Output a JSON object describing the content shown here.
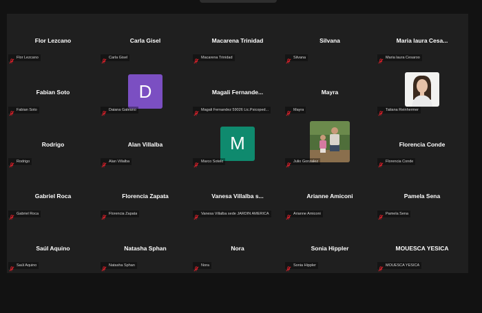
{
  "colors": {
    "background": "#121212",
    "grid_background": "#1f1f1f",
    "muted_mic": "#e0202a",
    "avatar_d": "#7b4fc2",
    "avatar_m": "#0f8a6e"
  },
  "participants": [
    {
      "display_name": "Flor Lezcano",
      "label": "Flor Lezcano",
      "mic_icon": "mic-muted-icon"
    },
    {
      "display_name": "Carla Gisel",
      "label": "Carla Gisel",
      "mic_icon": "mic-muted-icon"
    },
    {
      "display_name": "Macarena Trinidad",
      "label": "Macarena Trinidad",
      "mic_icon": "mic-muted-icon"
    },
    {
      "display_name": "Silvana",
      "label": "Silvana",
      "mic_icon": "mic-muted-icon"
    },
    {
      "display_name": "Maria laura Cesa...",
      "label": "Maria laura Cesaroo",
      "mic_icon": "mic-muted-icon"
    },
    {
      "display_name": "Fabian Soto",
      "label": "Fabian Soto",
      "mic_icon": "mic-muted-icon"
    },
    {
      "avatar_letter": "D",
      "label": "Daiana Galeano",
      "mic_icon": "mic-muted-icon"
    },
    {
      "display_name": "Magali  Fernande...",
      "label": "Magali Fernandez 59026 Lic.Psicoped...",
      "mic_icon": "mic-muted-icon"
    },
    {
      "display_name": "Mayra",
      "label": "Mayra",
      "mic_icon": "mic-muted-icon"
    },
    {
      "video": "woman-portrait",
      "label": "Tatiana Reinhermer",
      "mic_icon": "mic-muted-icon"
    },
    {
      "display_name": "Rodrigo",
      "label": "Rodrigo",
      "mic_icon": "mic-muted-icon"
    },
    {
      "display_name": "Alan Villalba",
      "label": "Alan Villalba",
      "mic_icon": "mic-muted-icon"
    },
    {
      "avatar_letter": "M",
      "label": "Marco Sotelo",
      "mic_icon": "mic-muted-icon"
    },
    {
      "video": "family-photo",
      "label": "Julio Gonzalez",
      "mic_icon": "mic-muted-icon"
    },
    {
      "display_name": "Florencia Conde",
      "label": "Florencia Conde",
      "mic_icon": "mic-muted-icon"
    },
    {
      "display_name": "Gabriel Roca",
      "label": "Gabriel Roca",
      "mic_icon": "mic-muted-icon"
    },
    {
      "display_name": "Florencia Zapata",
      "label": "Florencia Zapata",
      "mic_icon": "mic-muted-icon"
    },
    {
      "display_name": "Vanesa Villalba s...",
      "label": "Vanesa Villalba sede JARDIN AMERICA",
      "mic_icon": "mic-muted-icon"
    },
    {
      "display_name": "Arianne Amiconi",
      "label": "Arianne Amiconi",
      "mic_icon": "mic-muted-icon"
    },
    {
      "display_name": "Pamela Sena",
      "label": "Pamela Sena",
      "mic_icon": "mic-muted-icon"
    },
    {
      "display_name": "Saúl Aquino",
      "label": "Saúl Aquino",
      "mic_icon": "mic-muted-icon"
    },
    {
      "display_name": "Natasha Sphan",
      "label": "Natasha Sphan",
      "mic_icon": "mic-muted-icon"
    },
    {
      "display_name": "Nora",
      "label": "Nora",
      "mic_icon": "mic-muted-icon"
    },
    {
      "display_name": "Sonia Hippler",
      "label": "Sonia Hippler",
      "mic_icon": "mic-muted-icon"
    },
    {
      "display_name": "MOUESCA YESICA",
      "label": "MOUESCA YESICA",
      "mic_icon": "mic-muted-icon"
    }
  ]
}
